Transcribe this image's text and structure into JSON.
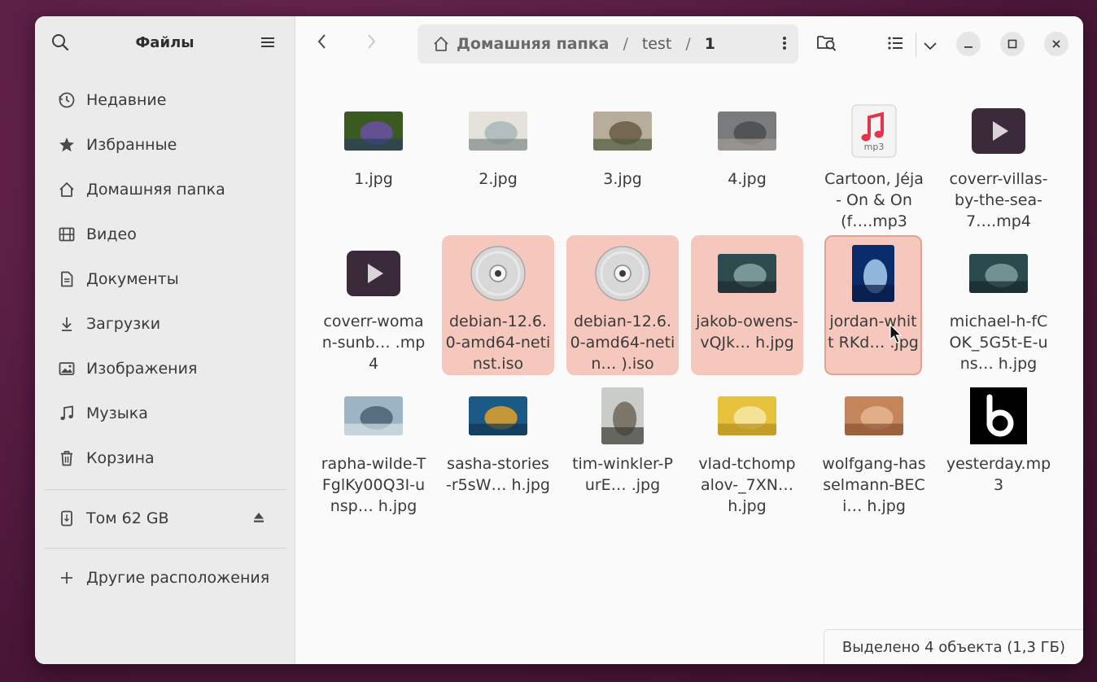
{
  "app": {
    "title": "Файлы"
  },
  "sidebar": {
    "items": [
      {
        "label": "Недавние",
        "icon": "clock-icon"
      },
      {
        "label": "Избранные",
        "icon": "star-icon"
      },
      {
        "label": "Домашняя папка",
        "icon": "home-icon"
      },
      {
        "label": "Видео",
        "icon": "film-icon"
      },
      {
        "label": "Документы",
        "icon": "document-icon"
      },
      {
        "label": "Загрузки",
        "icon": "download-icon"
      },
      {
        "label": "Изображения",
        "icon": "image-icon"
      },
      {
        "label": "Музыка",
        "icon": "music-icon"
      },
      {
        "label": "Корзина",
        "icon": "trash-icon"
      }
    ],
    "volume": {
      "label": "Том 62 GB",
      "icon": "drive-icon"
    },
    "other": {
      "label": "Другие расположения",
      "icon": "plus-icon"
    }
  },
  "path": {
    "segments": [
      "Домашняя папка",
      "test",
      "1"
    ],
    "separator": "/"
  },
  "files": [
    {
      "name": "1.jpg",
      "kind": "image",
      "palette": [
        "#3b5a22",
        "#6a4fa3",
        "#2c3d5e"
      ],
      "selected": false
    },
    {
      "name": "2.jpg",
      "kind": "image",
      "palette": [
        "#e4e2da",
        "#a9b7b8",
        "#7f8a88"
      ],
      "selected": false
    },
    {
      "name": "3.jpg",
      "kind": "image",
      "palette": [
        "#b7ad9c",
        "#6a5a45",
        "#4e5b3a"
      ],
      "selected": false
    },
    {
      "name": "4.jpg",
      "kind": "image",
      "palette": [
        "#7a7b7c",
        "#4b4c4e",
        "#a39d97"
      ],
      "selected": false
    },
    {
      "name": "Cartoon, Jéja - On & On (f….mp3",
      "kind": "audio",
      "selected": false
    },
    {
      "name": "coverr-villas-by-the-sea-7….mp4",
      "kind": "video",
      "selected": false
    },
    {
      "name": "coverr-woman-sunb… .mp4",
      "kind": "video",
      "selected": false
    },
    {
      "name": "debian-12.6.0-amd64-netinst.iso",
      "kind": "disc",
      "selected": true
    },
    {
      "name": "debian-12.6.0-amd64-netin… ).iso",
      "kind": "disc",
      "selected": true
    },
    {
      "name": "jakob-owens-vQJk… h.jpg",
      "kind": "image",
      "palette": [
        "#2f4a4f",
        "#86a4a3",
        "#1c2b2e"
      ],
      "selected": true
    },
    {
      "name": "jordan-whitt RKd… .jpg",
      "kind": "image",
      "palette": [
        "#0b2c6a",
        "#a8d0ef",
        "#071a44"
      ],
      "selected": true,
      "focused": true,
      "portrait": true
    },
    {
      "name": "michael-h-fCOK_5G5t-E-uns… h.jpg",
      "kind": "image",
      "palette": [
        "#2a4a4e",
        "#7f9ea0",
        "#162628"
      ],
      "selected": false
    },
    {
      "name": "rapha-wilde-TFglKy00Q3I-unsp… h.jpg",
      "kind": "image",
      "palette": [
        "#9cb4c4",
        "#4a6273",
        "#d8e1e6"
      ],
      "selected": false
    },
    {
      "name": "sasha-stories-r5sW… h.jpg",
      "kind": "image",
      "palette": [
        "#1b5a86",
        "#e0a22a",
        "#0f3550"
      ],
      "selected": false
    },
    {
      "name": "tim-winkler-PurE… .jpg",
      "kind": "image",
      "palette": [
        "#c9ccc8",
        "#6f6659",
        "#3c3a35"
      ],
      "selected": false,
      "portrait": true
    },
    {
      "name": "vlad-tchompalov-_7XN… h.jpg",
      "kind": "image",
      "palette": [
        "#e8c23d",
        "#f6e7a6",
        "#b38d1c"
      ],
      "selected": false
    },
    {
      "name": "wolfgang-hasselmann-BECi… h.jpg",
      "kind": "image",
      "palette": [
        "#c5855a",
        "#e6b58f",
        "#8a5133"
      ],
      "selected": false
    },
    {
      "name": "yesterday.mp3",
      "kind": "logo",
      "selected": false
    }
  ],
  "status": {
    "text": "Выделено 4 объекта  (1,3 ГБ)"
  },
  "audio_badge": "mp3"
}
